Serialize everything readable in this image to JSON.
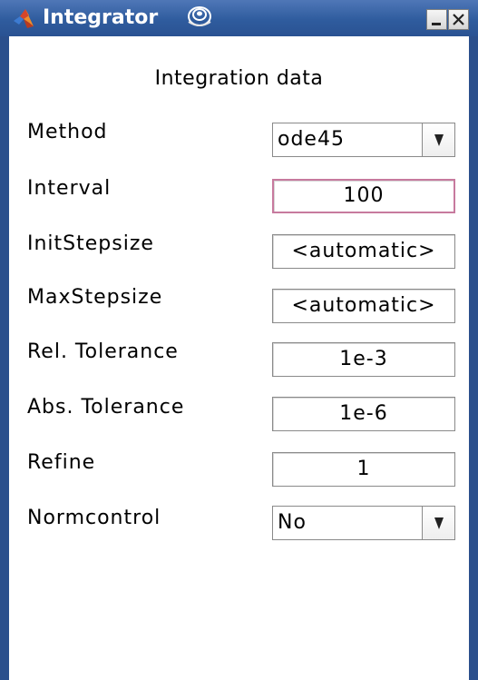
{
  "window": {
    "title": "Integrator",
    "icons": {
      "app": "matlab-icon",
      "rollup": "rollup-icon",
      "minimize": "minimize-icon",
      "close": "close-icon"
    },
    "colors": {
      "titlebar": "#2f5c9e",
      "frame": "#2b4f8c",
      "active_field_border": "#c77a9e"
    }
  },
  "panel": {
    "heading": "Integration data",
    "fields": {
      "method": {
        "label": "Method",
        "value": "ode45"
      },
      "interval": {
        "label": "Interval",
        "value": "100"
      },
      "initstep": {
        "label": "InitStepsize",
        "value": "<automatic>"
      },
      "maxstep": {
        "label": "MaxStepsize",
        "value": "<automatic>"
      },
      "reltol": {
        "label": "Rel. Tolerance",
        "value": "1e-3"
      },
      "abstol": {
        "label": "Abs. Tolerance",
        "value": "1e-6"
      },
      "refine": {
        "label": "Refine",
        "value": "1"
      },
      "normcontrol": {
        "label": "Normcontrol",
        "value": "No"
      }
    }
  }
}
